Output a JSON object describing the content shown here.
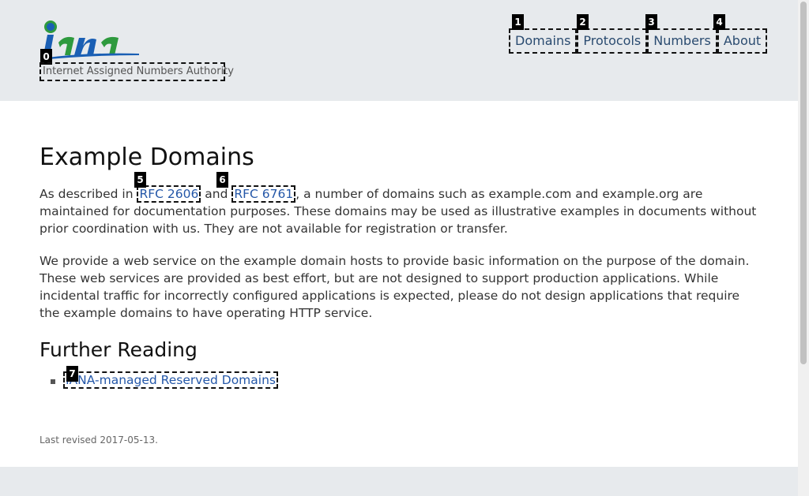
{
  "header": {
    "logo_tagline": "Internet Assigned Numbers Authority",
    "logo_wordmark": "iana"
  },
  "nav": {
    "items": [
      "Domains",
      "Protocols",
      "Numbers",
      "About"
    ]
  },
  "badges": [
    "0",
    "1",
    "2",
    "3",
    "4",
    "5",
    "6",
    "7"
  ],
  "main": {
    "title": "Example Domains",
    "para1_prefix": "As described in ",
    "rfc1": "RFC 2606",
    "para1_and": " and ",
    "rfc2": "RFC 6761",
    "para1_suffix": ", a number of domains such as example.com and example.org are maintained for documentation purposes. These domains may be used as illustrative examples in documents without prior coordination with us. They are not available for registration or transfer.",
    "para2": "We provide a web service on the example domain hosts to provide basic information on the purpose of the domain. These web services are provided as best effort, but are not designed to support production applications. While incidental traffic for incorrectly configured applications is expected, please do not design applications that require the example domains to have operating HTTP service.",
    "subtitle": "Further Reading",
    "reading_link": "IANA-managed Reserved Domains",
    "revised": "Last revised 2017-05-13."
  },
  "colors": {
    "header_bg": "#e7eaed",
    "link": "#2457a8",
    "nav_link": "#2a4b70",
    "logo_blue": "#1a5fb4",
    "logo_green": "#2e9a3e"
  }
}
